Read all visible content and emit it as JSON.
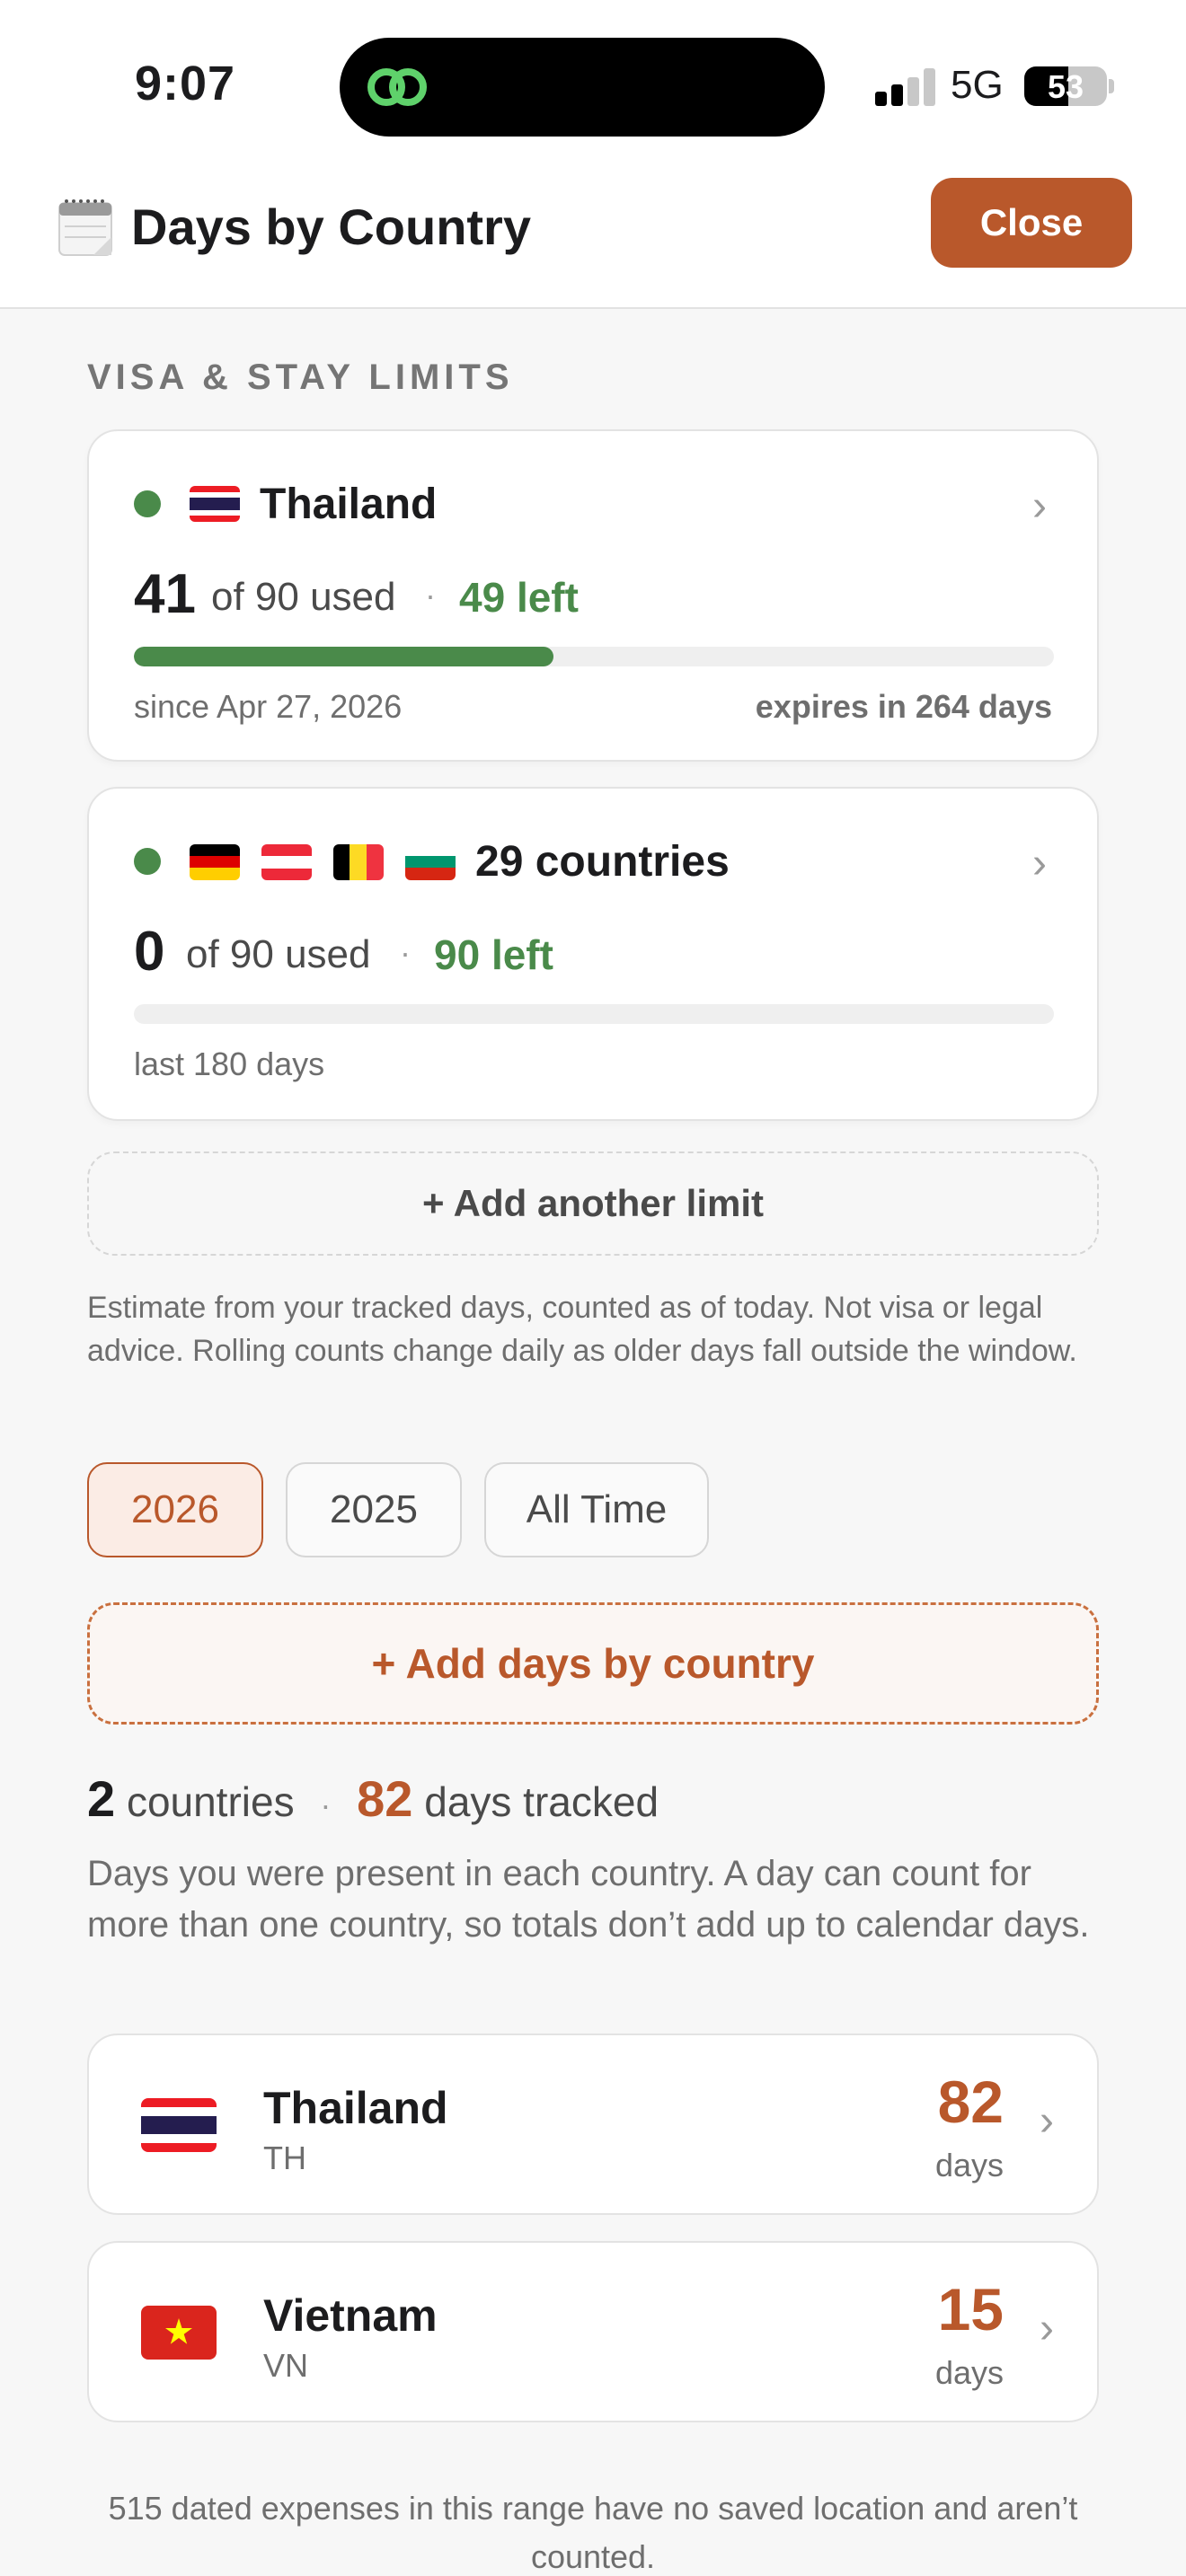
{
  "status_bar": {
    "time": "9:07",
    "network": "5G",
    "battery": "53",
    "battery_level": 0.53
  },
  "header": {
    "icon": "calendar-icon",
    "title": "Days by Country",
    "close_label": "Close"
  },
  "limits_section": {
    "label": "VISA & STAY LIMITS",
    "cards": [
      {
        "flags": [
          "thailand-flag"
        ],
        "title": "Thailand",
        "used": "41",
        "used_text": "of 90 used",
        "left_text": "49 left",
        "used_fraction": 0.456,
        "since_text": "since Apr 27, 2026",
        "expires_text": "expires in 264 days"
      },
      {
        "flags": [
          "germany-flag",
          "austria-flag",
          "belgium-flag",
          "bulgaria-flag"
        ],
        "title": "29 countries",
        "used": "0",
        "used_text": "of 90 used",
        "left_text": "90 left",
        "used_fraction": 0,
        "window_text": "last 180 days"
      }
    ],
    "add_limit_label": "+ Add another limit",
    "disclaimer": "Estimate from your tracked days, counted as of today. Not visa or legal advice. Rolling counts change daily as older days fall outside the window."
  },
  "range_tabs": [
    {
      "label": "2026",
      "active": true
    },
    {
      "label": "2025",
      "active": false
    },
    {
      "label": "All Time",
      "active": false
    }
  ],
  "add_days_label": "+ Add days by country",
  "summary": {
    "countries_count": "2",
    "countries_label": "countries",
    "days_count": "82",
    "days_label": "days tracked",
    "explanation": "Days you were present in each country. A day can count for more than one country, so totals don’t add up to calendar days."
  },
  "countries": [
    {
      "name": "Thailand",
      "code": "TH",
      "days": "82",
      "days_label": "days",
      "flag": "thailand-flag"
    },
    {
      "name": "Vietnam",
      "code": "VN",
      "days": "15",
      "days_label": "days",
      "flag": "vietnam-flag"
    }
  ],
  "footer_note": "515 dated expenses in this range have no saved location and aren’t counted.",
  "colors": {
    "accent": "#b9582b",
    "success": "#4a8a4a",
    "background": "#f7f7f7"
  }
}
